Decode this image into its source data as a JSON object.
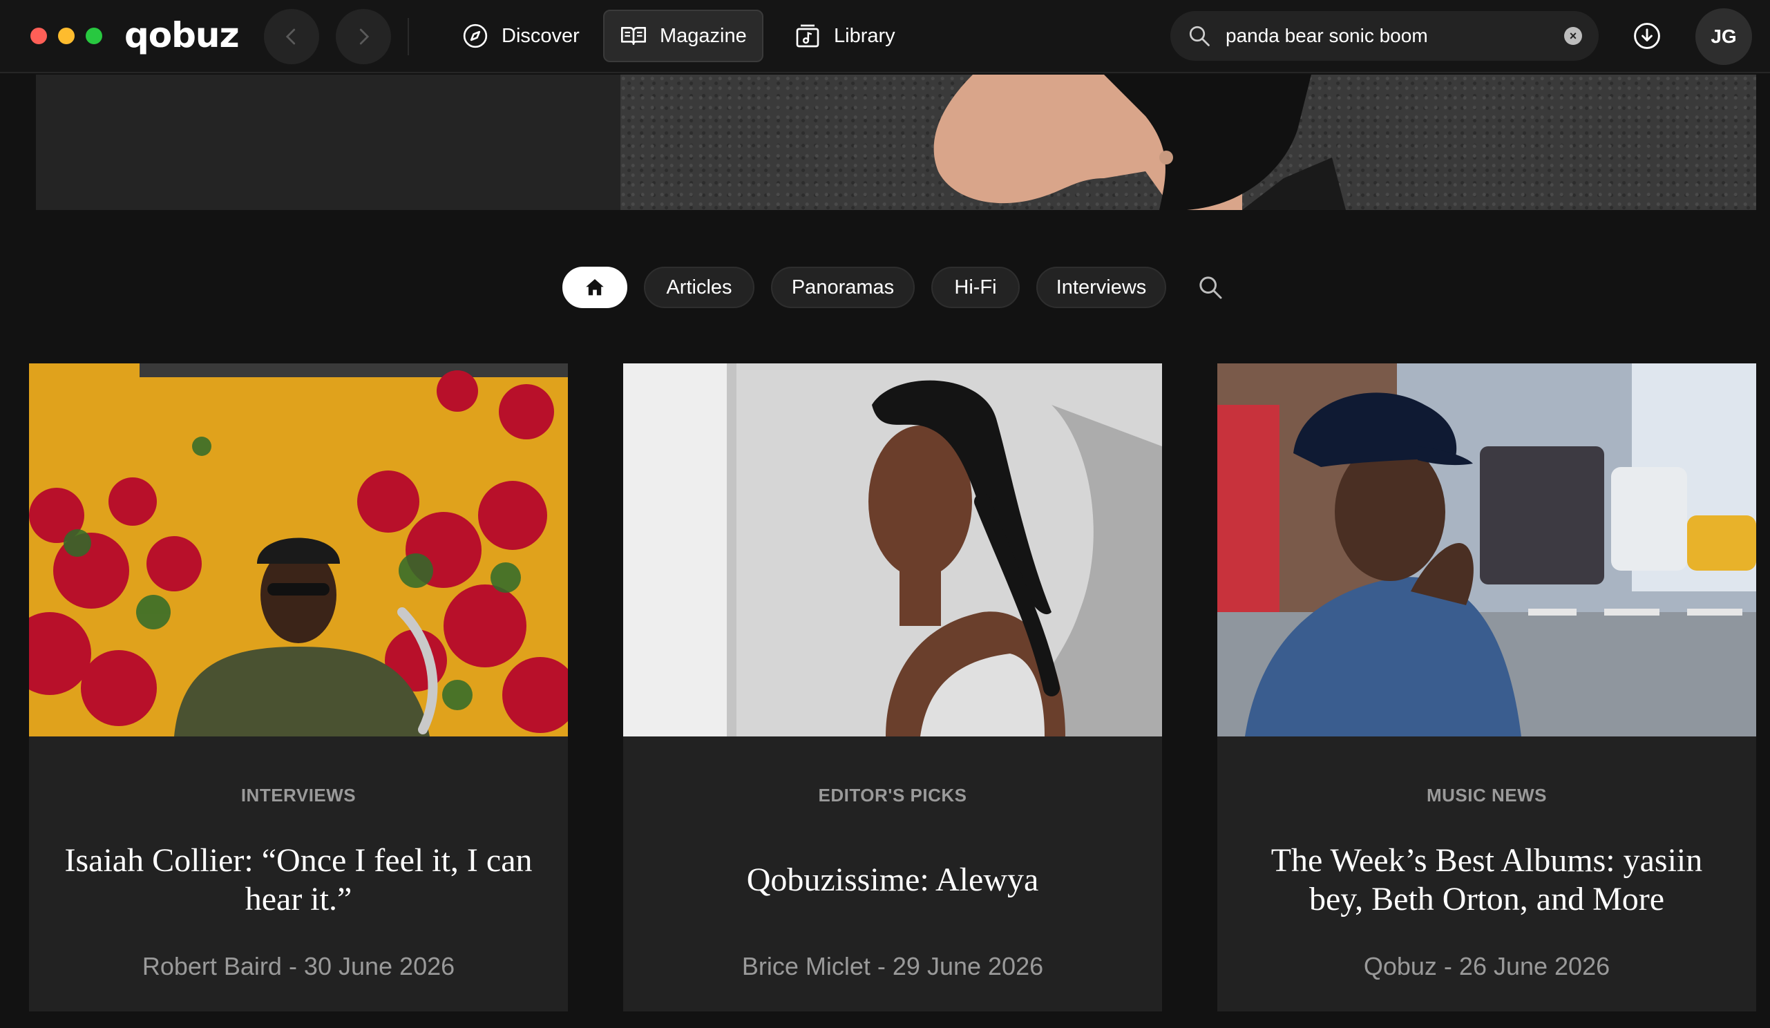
{
  "app": {
    "logo": "qobuz"
  },
  "nav": {
    "tabs": [
      {
        "label": "Discover",
        "icon": "compass-icon"
      },
      {
        "label": "Magazine",
        "icon": "open-book-icon",
        "active": true
      },
      {
        "label": "Library",
        "icon": "music-library-icon"
      }
    ]
  },
  "search": {
    "value": "panda bear sonic boom"
  },
  "user": {
    "initials": "JG"
  },
  "magazine": {
    "filters": [
      "Articles",
      "Panoramas",
      "Hi-Fi",
      "Interviews"
    ],
    "cards": [
      {
        "category": "INTERVIEWS",
        "title": "Isaiah Collier: “Once I feel it, I can hear it.”",
        "meta": "Robert Baird - 30 June 2026"
      },
      {
        "category": "EDITOR'S PICKS",
        "title": "Qobuzissime: Alewya",
        "meta": "Brice Miclet - 29 June 2026"
      },
      {
        "category": "MUSIC NEWS",
        "title": "The Week’s Best Albums: yasiin bey, Beth Orton, and More",
        "meta": "Qobuz - 26 June 2026"
      }
    ]
  },
  "colors": {
    "background": "#121212",
    "card": "#222222",
    "chip": "#232323",
    "muted_text": "#9a9a9a"
  }
}
